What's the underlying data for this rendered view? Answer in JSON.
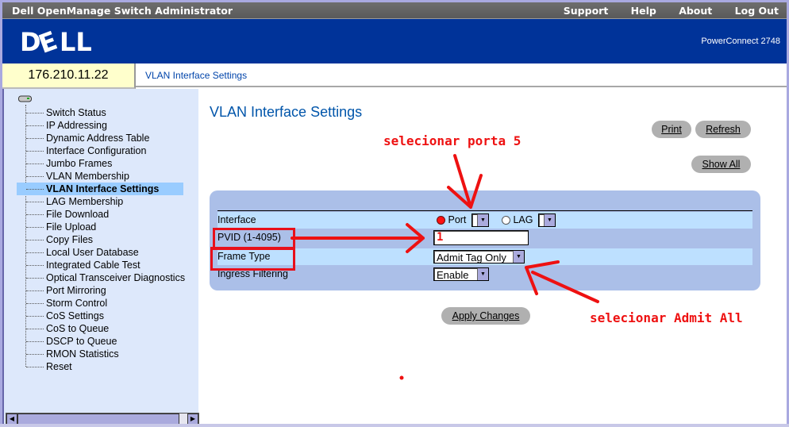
{
  "titlebar": {
    "app_title": "Dell OpenManage Switch Administrator",
    "nav": [
      "Support",
      "Help",
      "About",
      "Log Out"
    ]
  },
  "banner": {
    "logo_text": "DELL",
    "model": "PowerConnect 2748"
  },
  "ip_address": "176.210.11.22",
  "breadcrumb": "VLAN Interface Settings",
  "sidebar": {
    "items": [
      {
        "label": "Switch Status"
      },
      {
        "label": "IP Addressing"
      },
      {
        "label": "Dynamic Address Table"
      },
      {
        "label": "Interface Configuration"
      },
      {
        "label": "Jumbo Frames"
      },
      {
        "label": "VLAN Membership"
      },
      {
        "label": "VLAN Interface Settings",
        "active": true
      },
      {
        "label": "LAG Membership"
      },
      {
        "label": "File Download"
      },
      {
        "label": "File Upload"
      },
      {
        "label": "Copy Files"
      },
      {
        "label": "Local User Database"
      },
      {
        "label": "Integrated Cable Test"
      },
      {
        "label": "Optical Transceiver Diagnostics"
      },
      {
        "label": "Port Mirroring"
      },
      {
        "label": "Storm Control"
      },
      {
        "label": "CoS Settings"
      },
      {
        "label": "CoS to Queue"
      },
      {
        "label": "DSCP to Queue"
      },
      {
        "label": "RMON Statistics"
      },
      {
        "label": "Reset"
      }
    ]
  },
  "main": {
    "title": "VLAN Interface Settings",
    "buttons": {
      "print": "Print",
      "refresh": "Refresh",
      "show_all": "Show All",
      "apply": "Apply Changes"
    },
    "form": {
      "interface_label": "Interface",
      "port_label": "Port",
      "lag_label": "LAG",
      "port_selected": true,
      "port_value": "",
      "lag_value": "",
      "pvid_label": "PVID (1-4095)",
      "pvid_value": "1",
      "frame_type_label": "Frame Type",
      "frame_type_value": "Admit Tag Only",
      "ingress_label": "Ingress Filtering",
      "ingress_value": "Enable"
    }
  },
  "annotations": {
    "select_port": "selecionar porta 5",
    "select_admit_all": "selecionar Admit All",
    "color": "#ee1111"
  }
}
